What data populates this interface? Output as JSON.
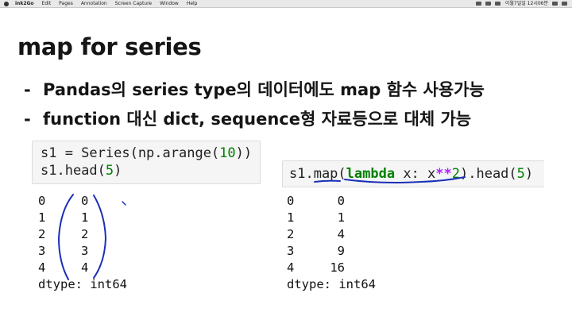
{
  "menubar": {
    "app_name": "ink2Go",
    "items": [
      "Edit",
      "Pages",
      "Annotation",
      "Screen Capture",
      "Window",
      "Help"
    ],
    "clock": "이월7일일 12시06분"
  },
  "slide": {
    "title": "map for series",
    "bullets": [
      {
        "dash": "-",
        "text": "Pandas의 series type의 데이터에도 map 함수 사용가능"
      },
      {
        "dash": "-",
        "text": "function 대신 dict, sequence형 자료등으로 대체 가능"
      }
    ]
  },
  "left_cell": {
    "code_line1": {
      "pre": "s1 = Series(np.arange(",
      "num": "10",
      "post": "))"
    },
    "code_line2": {
      "pre": "s1.head(",
      "num": "5",
      "post": ")"
    },
    "output": {
      "rows": [
        {
          "index": "0",
          "value": "0"
        },
        {
          "index": "1",
          "value": "1"
        },
        {
          "index": "2",
          "value": "2"
        },
        {
          "index": "3",
          "value": "3"
        },
        {
          "index": "4",
          "value": "4"
        }
      ],
      "dtype": "dtype: int64"
    }
  },
  "right_cell": {
    "code": {
      "a": "s1.map(",
      "kw": "lambda",
      "b": " x: x",
      "op": "**",
      "num1": "2",
      "c": ").head(",
      "num2": "5",
      "d": ")"
    },
    "output": {
      "rows": [
        {
          "index": "0",
          "value": "0"
        },
        {
          "index": "1",
          "value": "1"
        },
        {
          "index": "2",
          "value": "4"
        },
        {
          "index": "3",
          "value": "9"
        },
        {
          "index": "4",
          "value": "16"
        }
      ],
      "dtype": "dtype: int64"
    }
  },
  "annotations": {
    "ink_color": "#1a2fb8"
  }
}
